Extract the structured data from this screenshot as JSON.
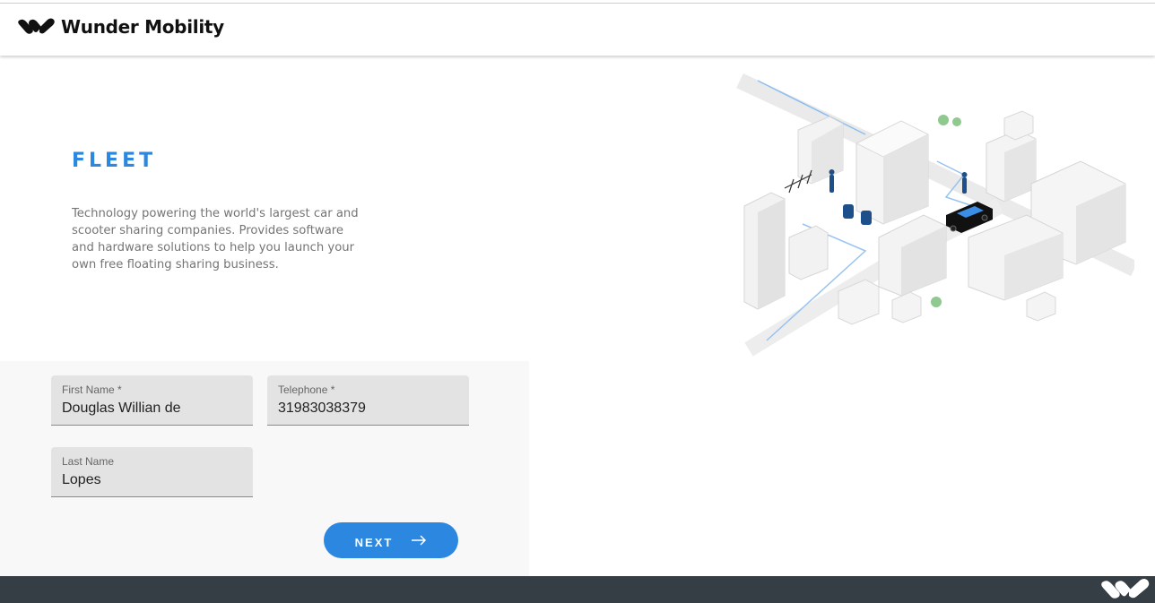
{
  "header": {
    "brand": "Wunder Mobility"
  },
  "hero": {
    "title": "FLEET",
    "description": "Technology powering the world's largest car and scooter sharing companies. Provides software and hardware solutions to help you launch your own free floating sharing business."
  },
  "form": {
    "first_name": {
      "label": "First Name *",
      "value": "Douglas Willian de"
    },
    "telephone": {
      "label": "Telephone *",
      "value": "31983038379"
    },
    "last_name": {
      "label": "Last Name",
      "value": "Lopes"
    },
    "next_label": "NEXT"
  },
  "colors": {
    "accent": "#2b87e0",
    "footer": "#363e45"
  },
  "icons": {
    "logo": "wunder-logo-icon",
    "next": "arrow-right-icon",
    "footer": "wunder-logo-icon"
  }
}
